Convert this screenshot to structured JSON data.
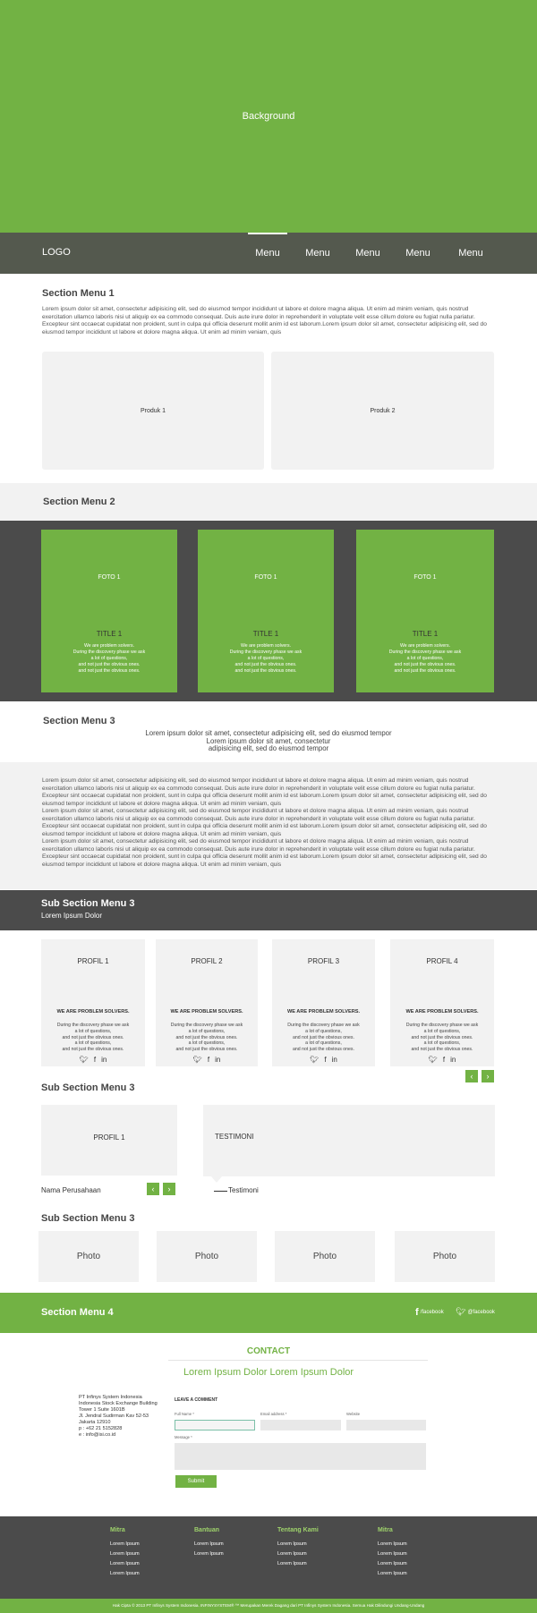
{
  "hero": {
    "label": "Background"
  },
  "nav": {
    "logo": "LOGO",
    "menus": [
      "Menu",
      "Menu",
      "Menu",
      "Menu",
      "Menu"
    ]
  },
  "section1": {
    "title": "Section Menu 1",
    "text": "Lorem ipsum dolor sit amet, consectetur adipisicing elit, sed do eiusmod tempor incididunt ut labore et dolore magna aliqua. Ut enim ad minim veniam, quis nostrud exercitation ullamco laboris nisi ut aliquip ex ea commodo consequat. Duis aute irure dolor in reprehenderit in voluptate velit esse cillum dolore eu fugiat nulla pariatur. Excepteur sint occaecat cupidatat non proident, sunt in culpa qui officia deserunt mollit anim id est laborum.Lorem ipsum dolor sit amet, consectetur adipisicing elit, sed do eiusmod tempor incididunt ut labore et dolore magna aliqua. Ut enim ad minim veniam, quis",
    "products": [
      "Produk 1",
      "Produk 2"
    ]
  },
  "section2": {
    "title": "Section Menu 2",
    "cards": [
      {
        "foto": "FOTO 1",
        "title": "TITLE 1",
        "desc": [
          "We are problem solvers.",
          "During the discovery phase we ask",
          "a lot of questions,",
          "and not just the obvious ones.",
          "and not just the obvious ones."
        ]
      },
      {
        "foto": "FOTO 1",
        "title": "TITLE 1",
        "desc": [
          "We are problem solvers.",
          "During the discovery phase we ask",
          "a lot of questions,",
          "and not just the obvious ones.",
          "and not just the obvious ones."
        ]
      },
      {
        "foto": "FOTO 1",
        "title": "TITLE 1",
        "desc": [
          "We are problem solvers.",
          "During the discovery phase we ask",
          "a lot of questions,",
          "and not just the obvious ones.",
          "and not just the obvious ones."
        ]
      }
    ]
  },
  "section3": {
    "title": "Section Menu 3",
    "intro": [
      "Lorem ipsum dolor sit amet, consectetur adipisicing elit, sed do eiusmod tempor",
      "Lorem ipsum dolor sit amet, consectetur",
      "adipisicing elit, sed do eiusmod tempor"
    ],
    "body": [
      "Lorem ipsum dolor sit amet, consectetur adipisicing elit, sed do eiusmod tempor incididunt ut labore et dolore magna aliqua. Ut enim ad minim veniam, quis nostrud exercitation ullamco laboris nisi ut aliquip ex ea commodo consequat. Duis aute irure dolor in reprehenderit in voluptate velit esse cillum dolore eu fugiat nulla pariatur. Excepteur sint occaecat cupidatat non proident, sunt in culpa qui officia deserunt mollit anim id est laborum.Lorem ipsum dolor sit amet, consectetur adipisicing elit, sed do eiusmod tempor incididunt ut labore et dolore magna aliqua. Ut enim ad minim veniam, quis",
      "Lorem ipsum dolor sit amet, consectetur adipisicing elit, sed do eiusmod tempor incididunt ut labore et dolore magna aliqua. Ut enim ad minim veniam, quis nostrud exercitation ullamco laboris nisi ut aliquip ex ea commodo consequat. Duis aute irure dolor in reprehenderit in voluptate velit esse cillum dolore eu fugiat nulla pariatur. Excepteur sint occaecat cupidatat non proident, sunt in culpa qui officia deserunt mollit anim id est laborum.Lorem ipsum dolor sit amet, consectetur adipisicing elit, sed do eiusmod tempor incididunt ut labore et dolore magna aliqua. Ut enim ad minim veniam, quis",
      "Lorem ipsum dolor sit amet, consectetur adipisicing elit, sed do eiusmod tempor incididunt ut labore et dolore magna aliqua. Ut enim ad minim veniam, quis nostrud exercitation ullamco laboris nisi ut aliquip ex ea commodo consequat. Duis aute irure dolor in reprehenderit in voluptate velit esse cillum dolore eu fugiat nulla pariatur. Excepteur sint occaecat cupidatat non proident, sunt in culpa qui officia deserunt mollit anim id est laborum.Lorem ipsum dolor sit amet, consectetur adipisicing elit, sed do eiusmod tempor incididunt ut labore et dolore magna aliqua. Ut enim ad minim veniam, quis"
    ]
  },
  "sub3a": {
    "title": "Sub Section Menu 3",
    "subtitle": "Lorem Ipsum Dolor",
    "profiles": [
      {
        "title": "PROFIL 1",
        "head": "WE ARE PROBLEM SOLVERS.",
        "desc": [
          "During the discovery phase we ask",
          "a lot of questions,",
          "and not just the obvious ones.",
          "a lot of questions,",
          "and not just the obvious ones."
        ]
      },
      {
        "title": "PROFIL 2",
        "head": "WE ARE PROBLEM SOLVERS.",
        "desc": [
          "During the discovery phase we ask",
          "a lot of questions,",
          "and not just the obvious ones.",
          "a lot of questions,",
          "and not just the obvious ones."
        ]
      },
      {
        "title": "PROFIL 3",
        "head": "WE ARE PROBLEM SOLVERS.",
        "desc": [
          "During the discovery phase we ask",
          "a lot of questions,",
          "and not just the obvious ones.",
          "a lot of questions,",
          "and not just the obvious ones."
        ]
      },
      {
        "title": "PROFIL 4",
        "head": "WE ARE PROBLEM SOLVERS.",
        "desc": [
          "During the discovery phase we ask",
          "a lot of questions,",
          "and not just the obvious ones.",
          "a lot of questions,",
          "and not just the obvious ones."
        ]
      }
    ],
    "social_icons": [
      "twitter-icon",
      "facebook-icon",
      "linkedin-icon"
    ]
  },
  "sub3b": {
    "title": "Sub Section Menu 3",
    "profile": "PROFIL 1",
    "company": "Nama Perusahaan",
    "testimoni_title": "TESTIMONI",
    "testimoni_author": "Testimoni"
  },
  "sub3c": {
    "title": "Sub Section Menu 3",
    "photos": [
      "Photo",
      "Photo",
      "Photo",
      "Photo"
    ]
  },
  "section4": {
    "title": "Section Menu 4",
    "facebook1": "/facebook",
    "facebook2": "@facebook"
  },
  "contact": {
    "title": "CONTACT",
    "subtitle": "Lorem Ipsum Dolor Lorem Ipsum Dolor",
    "address": [
      "PT Infinys System Indonesia",
      "Indonesia Stock Exchange Building",
      "Tower 1 Suite 1601B",
      "Jl. Jendral Sudirman Kav 52-53",
      "Jakarta 12910",
      "p : +62 21 5152828",
      "e : info@isi.co.id"
    ],
    "form_title": "LEAVE A COMMENT",
    "labels": {
      "name": "Full Name *",
      "email": "Email address *",
      "website": "Website",
      "message": "Message *"
    },
    "submit": "Submit"
  },
  "footer": {
    "columns": [
      {
        "head": "Mitra",
        "items": [
          "Lorem Ipsum",
          "Lorem Ipsum",
          "Lorem Ipsum",
          "Lorem Ipsum"
        ]
      },
      {
        "head": "Bantuan",
        "items": [
          "Lorem Ipsum",
          "Lorem Ipsum"
        ]
      },
      {
        "head": "Tentang Kami",
        "items": [
          "Lorem Ipsum",
          "Lorem Ipsum",
          "Lorem Ipsum"
        ]
      },
      {
        "head": "Mitra",
        "items": [
          "Lorem Ipsum",
          "Lorem Ipsum",
          "Lorem Ipsum",
          "Lorem Ipsum"
        ]
      }
    ],
    "copyright": "Hak Cipta © 2013 PT Infinys System Indonesia. INFINYSYSTEM® ™ Merupakan Merek Dagang dari PT Infinys System Indonesia. Semua Hak Dilindungi Undang-Undang"
  },
  "colors": {
    "green": "#72b244",
    "dark": "#4b4b4b",
    "light": "#f2f2f2"
  }
}
